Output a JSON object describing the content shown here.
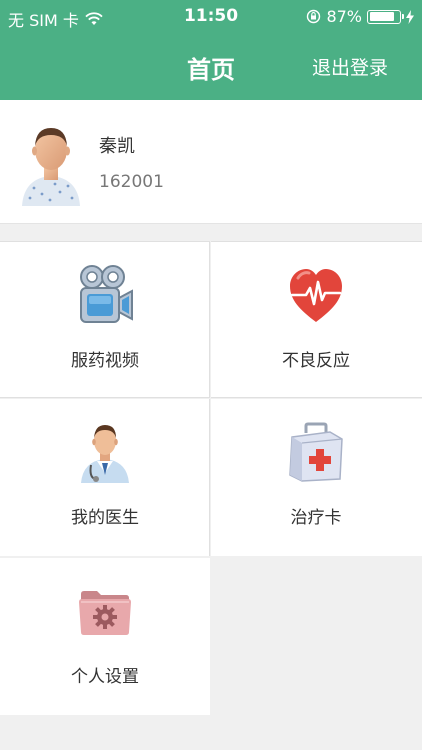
{
  "status_bar": {
    "carrier": "无 SIM 卡",
    "time": "11:50",
    "battery_percent": "87%",
    "battery_level": 0.87
  },
  "nav": {
    "title": "首页",
    "logout_label": "退出登录"
  },
  "user": {
    "name": "秦凯",
    "id": "162001"
  },
  "menu": [
    {
      "label": "服药视频",
      "icon": "video-camera-icon"
    },
    {
      "label": "不良反应",
      "icon": "heart-pulse-icon"
    },
    {
      "label": "我的医生",
      "icon": "doctor-icon"
    },
    {
      "label": "治疗卡",
      "icon": "first-aid-kit-icon"
    },
    {
      "label": "个人设置",
      "icon": "settings-folder-icon"
    }
  ],
  "colors": {
    "primary": "#4bb085",
    "heart": "#e2453b",
    "background": "#f0f0f0"
  }
}
